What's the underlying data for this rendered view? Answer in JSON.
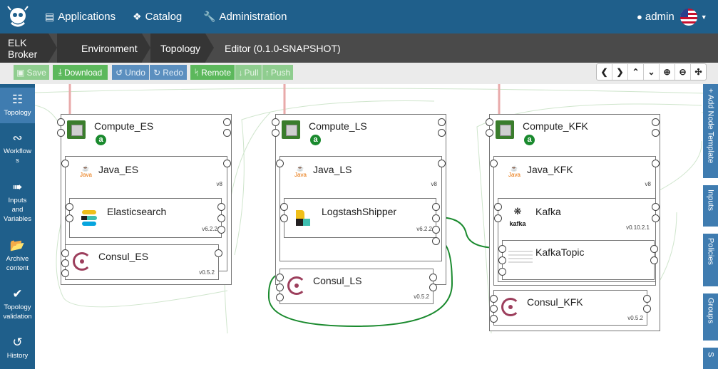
{
  "topnav": {
    "applications": "Applications",
    "catalog": "Catalog",
    "administration": "Administration",
    "user": "admin"
  },
  "breadcrumbs": [
    "ELK Broker",
    "Environment",
    "Topology",
    "Editor (0.1.0-SNAPSHOT)"
  ],
  "toolbar": {
    "save": "Save",
    "download": "Download",
    "undo": "Undo",
    "redo": "Redo",
    "remote": "Remote",
    "pull": "Pull",
    "push": "Push"
  },
  "leftbar": [
    {
      "icon": "sitemap-icon",
      "label": "Topology"
    },
    {
      "icon": "workflow-icon",
      "label": "Workflows"
    },
    {
      "icon": "sign-in-icon",
      "label": "Inputs and Variables"
    },
    {
      "icon": "folder-open-icon",
      "label": "Archive content"
    },
    {
      "icon": "check-icon",
      "label": "Topology validation"
    },
    {
      "icon": "history-icon",
      "label": "History"
    }
  ],
  "rightbar": [
    {
      "label": "+ Add Node Template"
    },
    {
      "label": "Inputs"
    },
    {
      "label": "Policies"
    },
    {
      "label": "Groups"
    },
    {
      "label": "S"
    }
  ],
  "nodes": {
    "compute_es": {
      "name": "Compute_ES",
      "badge": "a"
    },
    "java_es": {
      "name": "Java_ES",
      "version": "v8",
      "logo_text": "Java"
    },
    "elasticsearch": {
      "name": "Elasticsearch",
      "version": "v6.2.2"
    },
    "consul_es": {
      "name": "Consul_ES",
      "version": "v0.5.2"
    },
    "compute_ls": {
      "name": "Compute_LS",
      "badge": "a"
    },
    "java_ls": {
      "name": "Java_LS",
      "version": "v8",
      "logo_text": "Java"
    },
    "logstash": {
      "name": "LogstashShipper",
      "version": "v6.2.2"
    },
    "consul_ls": {
      "name": "Consul_LS",
      "version": "v0.5.2"
    },
    "compute_kfk": {
      "name": "Compute_KFK",
      "badge": "a"
    },
    "java_kfk": {
      "name": "Java_KFK",
      "version": "v8",
      "logo_text": "Java"
    },
    "kafka": {
      "name": "Kafka",
      "version": "v0.10.2.1",
      "logo_text": "kafka"
    },
    "kafkatopic": {
      "name": "KafkaTopic"
    },
    "consul_kfk": {
      "name": "Consul_KFK",
      "version": "v0.5.2"
    }
  },
  "colors": {
    "nav": "#1f5f8b",
    "crumbs": "#4a4a4a",
    "green": "#5cb85c",
    "blue": "#5b8fbf",
    "link_green": "#1a8a2e"
  }
}
